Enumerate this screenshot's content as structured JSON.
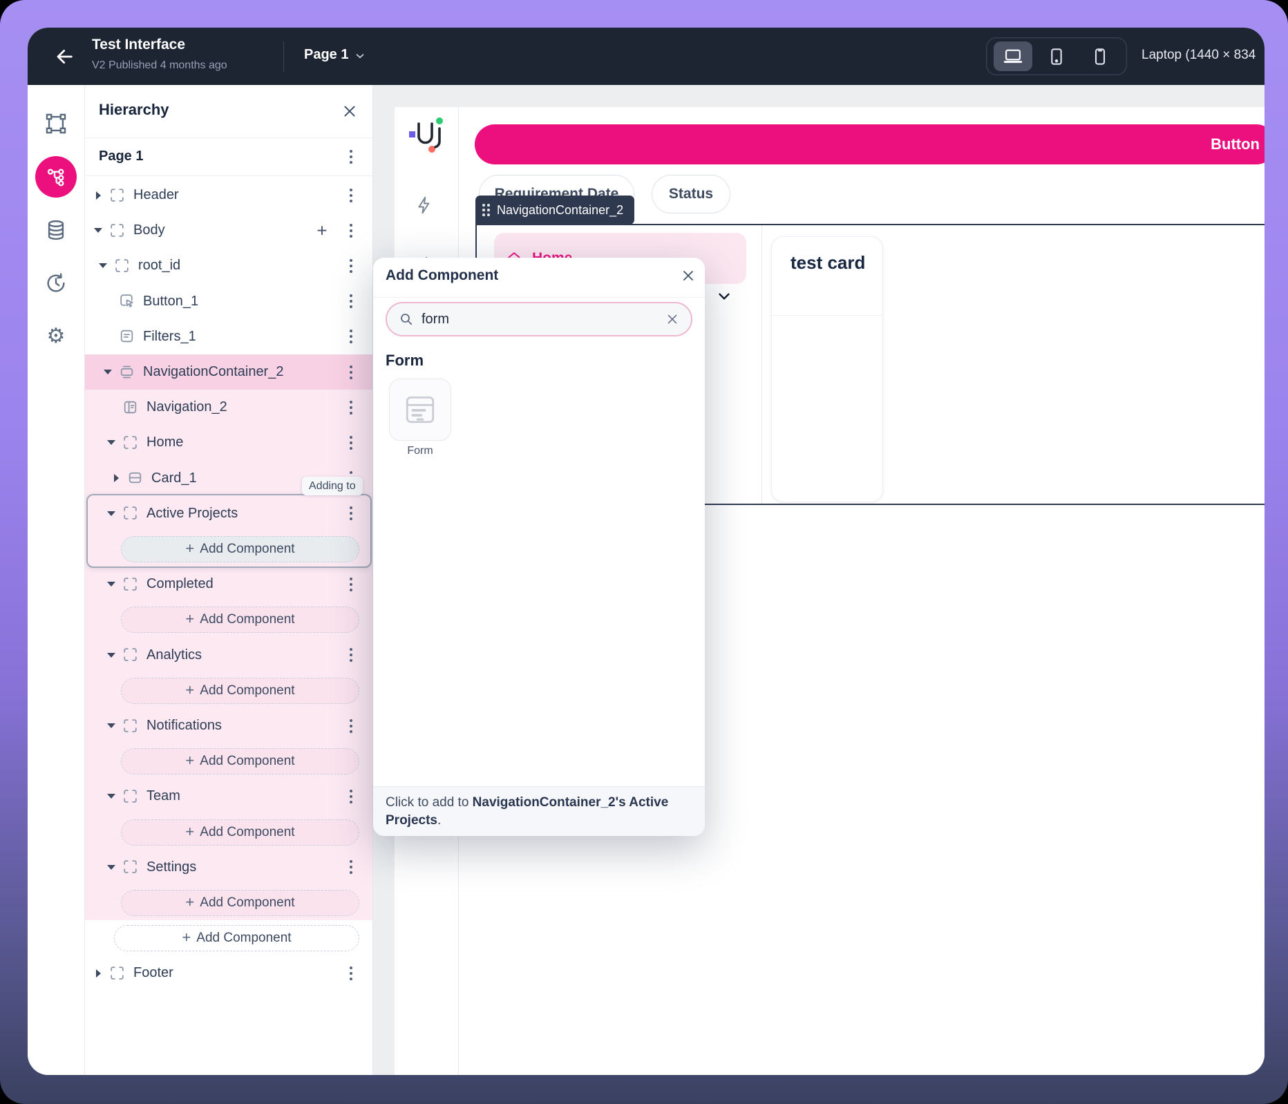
{
  "topbar": {
    "title": "Test Interface",
    "subtitle": "V2 Published 4 months ago",
    "page_selector": "Page 1",
    "device_label": "Laptop (1440 × 834",
    "devices": [
      {
        "name": "laptop",
        "active": true
      },
      {
        "name": "tablet",
        "active": false
      },
      {
        "name": "phone",
        "active": false
      }
    ]
  },
  "icon_rail": {
    "items": [
      {
        "name": "select-frame",
        "active": false
      },
      {
        "name": "hierarchy-tree",
        "active": true
      },
      {
        "name": "data",
        "active": false
      },
      {
        "name": "history",
        "active": false
      },
      {
        "name": "settings",
        "active": false
      }
    ]
  },
  "hierarchy_panel": {
    "title": "Hierarchy",
    "page_label": "Page 1",
    "adding_to_label": "Adding to",
    "add_component_label": "Add Component",
    "rows": [
      {
        "type": "item",
        "label": "Header",
        "depth": 0,
        "caret": "right",
        "icon": "frame",
        "kebab": true
      },
      {
        "type": "item",
        "label": "Body",
        "depth": 0,
        "caret": "down",
        "icon": "frame",
        "kebab": true,
        "plus": true
      },
      {
        "type": "item",
        "label": "root_id",
        "depth": 1,
        "caret": "down",
        "icon": "frame",
        "kebab": true
      },
      {
        "type": "item",
        "label": "Button_1",
        "depth": 2,
        "caret": "none",
        "icon": "cursor",
        "kebab": true
      },
      {
        "type": "item",
        "label": "Filters_1",
        "depth": 2,
        "caret": "none",
        "icon": "filters",
        "kebab": true
      },
      {
        "type": "item",
        "label": "NavigationContainer_2",
        "depth": 2,
        "caret": "down",
        "icon": "container",
        "kebab": true
      },
      {
        "type": "item",
        "label": "Navigation_2",
        "depth": 3,
        "caret": "none",
        "icon": "navigation",
        "kebab": true
      },
      {
        "type": "item",
        "label": "Home",
        "depth": 3,
        "caret": "down",
        "icon": "frame",
        "kebab": true
      },
      {
        "type": "item",
        "label": "Card_1",
        "depth": 4,
        "caret": "right",
        "icon": "card",
        "kebab": true
      },
      {
        "type": "item",
        "label": "Active Projects",
        "depth": 3,
        "caret": "down",
        "icon": "frame",
        "kebab": true
      },
      {
        "type": "add",
        "style": "gray"
      },
      {
        "type": "item",
        "label": "Completed",
        "depth": 3,
        "caret": "down",
        "icon": "frame",
        "kebab": true
      },
      {
        "type": "add",
        "style": "pink"
      },
      {
        "type": "item",
        "label": "Analytics",
        "depth": 3,
        "caret": "down",
        "icon": "frame",
        "kebab": true
      },
      {
        "type": "add",
        "style": "pink"
      },
      {
        "type": "item",
        "label": "Notifications",
        "depth": 3,
        "caret": "down",
        "icon": "frame",
        "kebab": true
      },
      {
        "type": "add",
        "style": "pink"
      },
      {
        "type": "item",
        "label": "Team",
        "depth": 3,
        "caret": "down",
        "icon": "frame",
        "kebab": true
      },
      {
        "type": "add",
        "style": "pink"
      },
      {
        "type": "item",
        "label": "Settings",
        "depth": 3,
        "caret": "down",
        "icon": "frame",
        "kebab": true
      },
      {
        "type": "add",
        "style": "pink"
      },
      {
        "type": "add",
        "style": "white"
      },
      {
        "type": "item",
        "label": "Footer",
        "depth": 0,
        "caret": "right",
        "icon": "frame",
        "kebab": true
      }
    ]
  },
  "modal": {
    "title": "Add Component",
    "search_value": "form",
    "section_title": "Form",
    "tile_label": "Form",
    "footer_prefix": "Click to add to ",
    "footer_bold": "NavigationContainer_2's Active Projects",
    "footer_suffix": "."
  },
  "canvas": {
    "button_label": "Button",
    "pill_requirement_date": "Requirement Date",
    "pill_status": "Status",
    "selection_tooltip": "NavigationContainer_2",
    "nav_home_label": "Home",
    "card_title": "test card"
  },
  "colors": {
    "accent_pink": "#ec0f7e",
    "selection_navy": "#2e3950",
    "row_pink_selected": "#f8d2e4",
    "row_pink_light": "#fce9f2",
    "topbar_bg": "#1d2432"
  }
}
